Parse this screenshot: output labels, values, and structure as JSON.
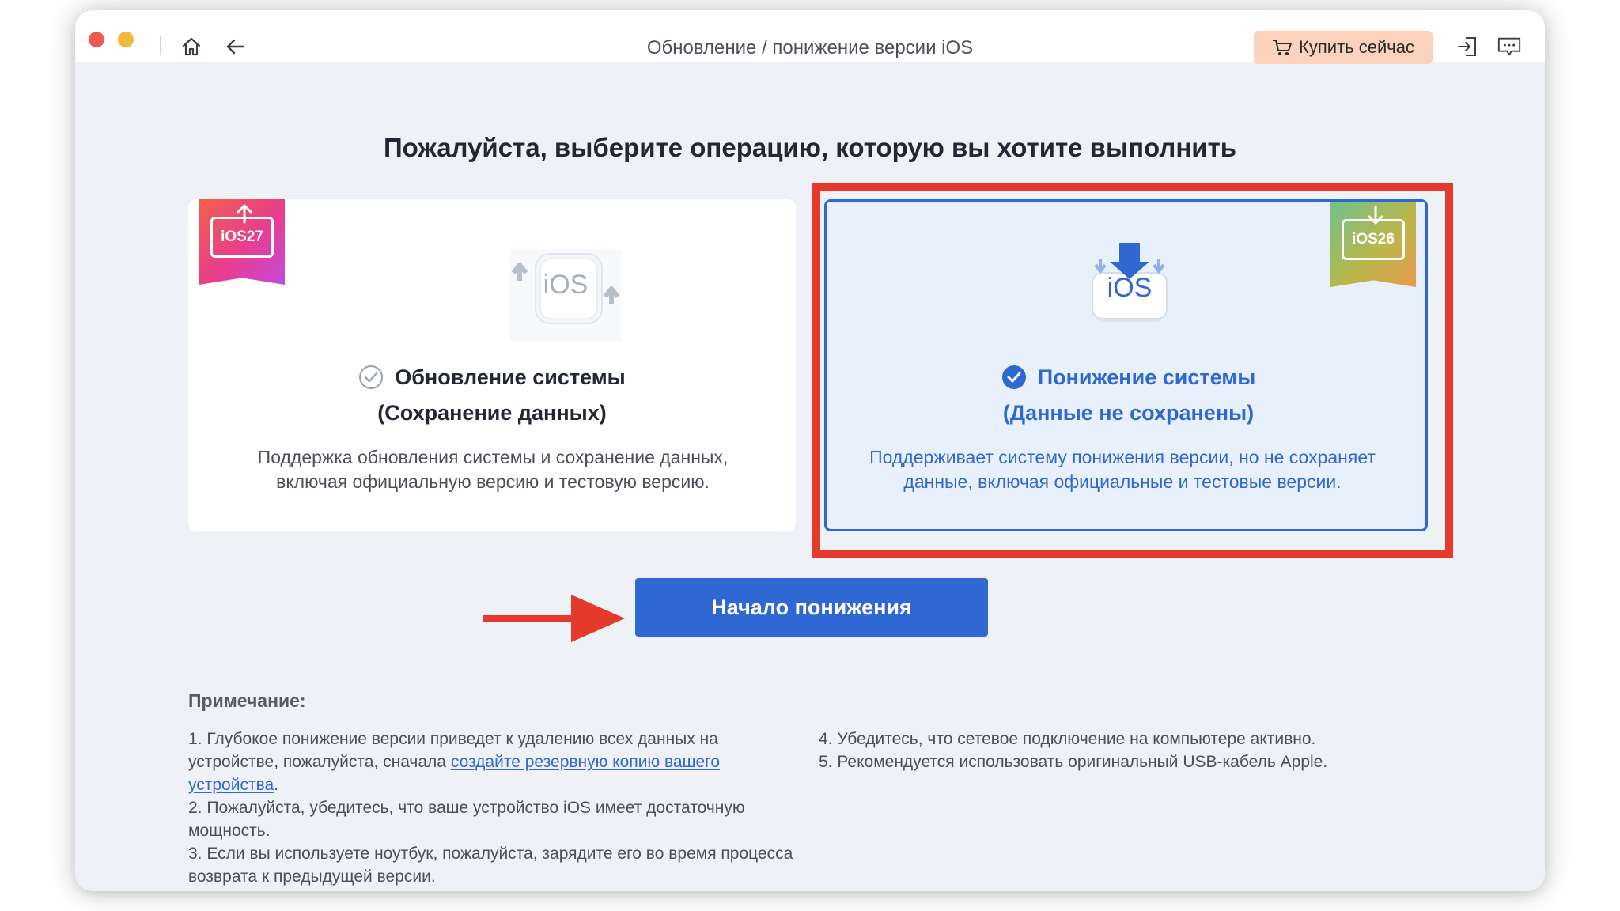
{
  "window": {
    "title": "Обновление / понижение версии iOS",
    "buy_label": "Купить сейчас",
    "icons": [
      "home-icon",
      "back-arrow-icon",
      "cart-icon",
      "login-icon",
      "feedback-icon"
    ]
  },
  "main": {
    "heading": "Пожалуйста, выберите операцию, которую вы хотите выполнить",
    "upgrade_card": {
      "badge": "iOS27",
      "icon_text": "iOS",
      "title": "Обновление системы",
      "subtitle": "(Сохранение данных)",
      "description": "Поддержка обновления системы и сохранение данных, включая официальную версию и тестовую версию.",
      "selected": false
    },
    "downgrade_card": {
      "badge": "iOS26",
      "icon_text": "iOS",
      "title": "Понижение системы",
      "subtitle": "(Данные не сохранены)",
      "description": "Поддерживает систему понижения версии, но не сохраняет данные, включая официальные и тестовые версии.",
      "selected": true
    },
    "start_button": "Начало понижения"
  },
  "notes": {
    "title": "Примечание:",
    "n1_before": "1. Глубокое понижение версии приведет к удалению всех данных на устройстве, пожалуйста, сначала ",
    "n1_link": "создайте резервную копию вашего устройства",
    "n1_after": ".",
    "n2": "2. Пожалуйста, убедитесь, что ваше устройство iOS имеет достаточную мощность.",
    "n3": "3. Если вы используете ноутбук, пожалуйста, зарядите его во время процесса возврата к предыдущей версии.",
    "n4": "4. Убедитесь, что сетевое подключение на компьютере активно.",
    "n5": "5. Рекомендуется использовать оригинальный USB-кабель Apple."
  },
  "colors": {
    "accent": "#2f67d3",
    "highlight_red": "#e4392b",
    "buy_bg": "#fbd3bd"
  }
}
